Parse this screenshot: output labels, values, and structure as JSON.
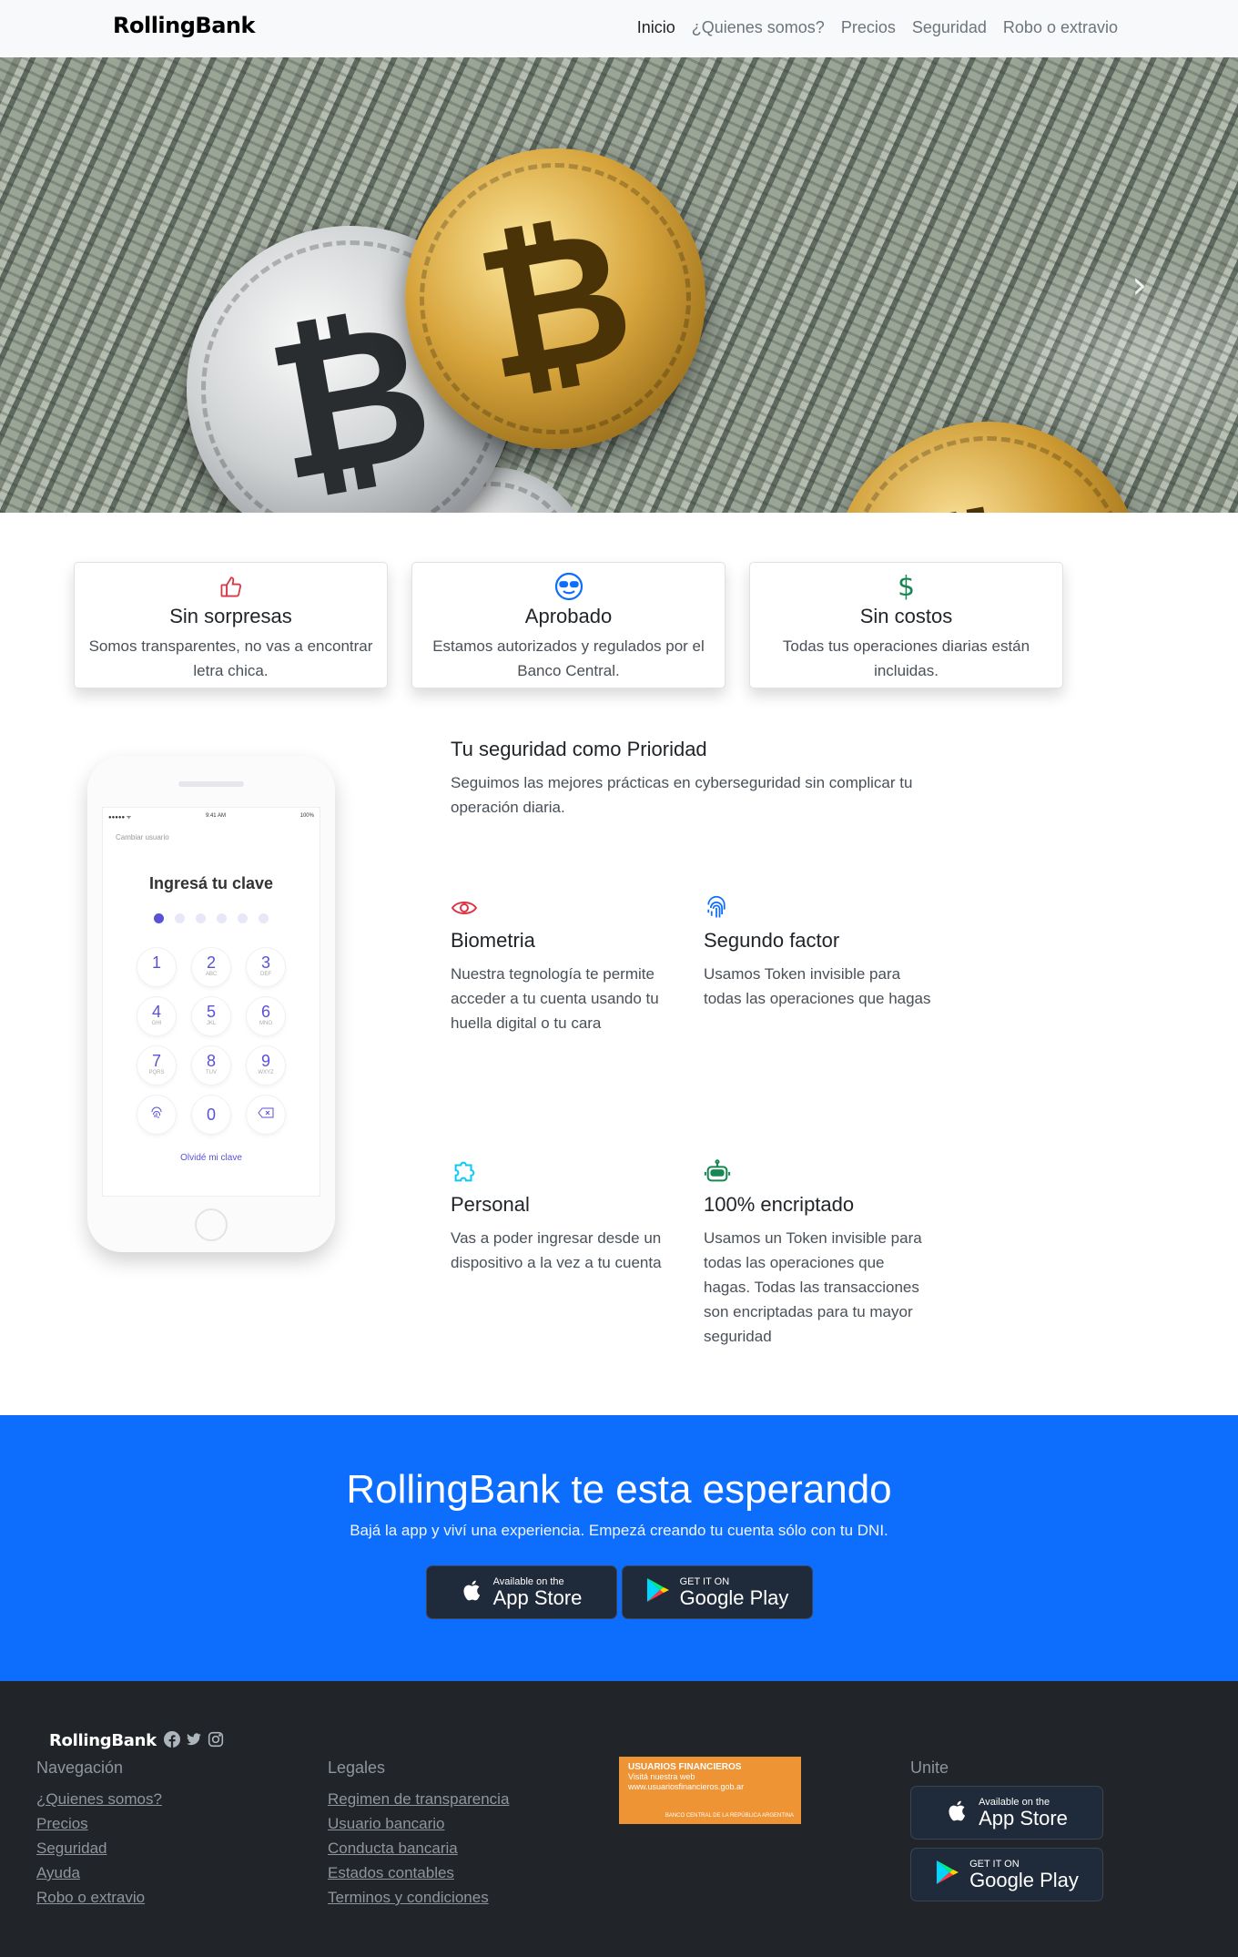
{
  "nav": {
    "brand": "RollingBank",
    "links": [
      "Inicio",
      "¿Quienes somos?",
      "Precios",
      "Seguridad",
      "Robo o extravio"
    ]
  },
  "hero": {
    "coin_symbol": "₿",
    "next_arrow": "›"
  },
  "features": [
    {
      "icon": "thumbs-up-icon",
      "title": "Sin sorpresas",
      "text": "Somos transparentes, no vas a encontrar letra chica."
    },
    {
      "icon": "sunglasses-emoji-icon",
      "title": "Aprobado",
      "text": "Estamos autorizados y regulados por el Banco Central."
    },
    {
      "icon": "dollar-icon",
      "title": "Sin costos",
      "text": "Todas tus operaciones diarias están incluidas."
    }
  ],
  "phone": {
    "status_left": "●●●●● ᯤ",
    "status_time": "9:41 AM",
    "status_right": "100%",
    "switch_user": "Cambiar usuario",
    "title": "Ingresá tu clave",
    "keys": [
      {
        "d": "1",
        "l": ""
      },
      {
        "d": "2",
        "l": "ABC"
      },
      {
        "d": "3",
        "l": "DEF"
      },
      {
        "d": "4",
        "l": "GHI"
      },
      {
        "d": "5",
        "l": "JKL"
      },
      {
        "d": "6",
        "l": "MNO"
      },
      {
        "d": "7",
        "l": "PQRS"
      },
      {
        "d": "8",
        "l": "TUV"
      },
      {
        "d": "9",
        "l": "WXYZ"
      }
    ],
    "zero": "0",
    "forgot": "Olvidé mi clave"
  },
  "security": {
    "title": "Tu seguridad como Prioridad",
    "subtitle": "Seguimos las mejores prácticas en cyberseguridad sin complicar tu operación diaria.",
    "items": [
      {
        "icon": "eye-icon",
        "title": "Biometria",
        "text": "Nuestra tegnología te permite acceder a tu cuenta usando tu huella digital o tu cara"
      },
      {
        "icon": "fingerprint-icon",
        "title": "Segundo factor",
        "text": "Usamos Token invisible para todas las operaciones que hagas"
      },
      {
        "icon": "puzzle-icon",
        "title": "Personal",
        "text": "Vas a poder ingresar desde un dispositivo a la vez a tu cuenta"
      },
      {
        "icon": "robot-icon",
        "title": "100% encriptado",
        "text": "Usamos un Token invisible para todas las operaciones que hagas. Todas las transacciones son encriptadas para tu mayor seguridad"
      }
    ]
  },
  "cta": {
    "title": "RollingBank te esta esperando",
    "subtitle": "Bajá la app y viví una experiencia. Empezá creando tu cuenta sólo con tu DNI.",
    "appstore_small": "Available on the",
    "appstore_big": "App Store",
    "googleplay_small": "GET IT ON",
    "googleplay_big": "Google Play"
  },
  "footer": {
    "brand": "RollingBank",
    "nav_title": "Navegación",
    "nav_links": [
      "¿Quienes somos?",
      "Precios",
      "Seguridad",
      "Ayuda",
      "Robo o extravio"
    ],
    "legal_title": "Legales",
    "legal_links": [
      "Regimen de transparencia",
      "Usuario bancario",
      "Conducta bancaria",
      "Estados contables",
      "Terminos y condiciones"
    ],
    "uf_title": "USUARIOS FINANCIEROS",
    "uf_line1": "Visitá nuestra web",
    "uf_line2": "www.usuariosfinancieros.gob.ar",
    "uf_org": "BANCO CENTRAL DE LA REPÚBLICA ARGENTINA",
    "unite_title": "Unite"
  },
  "colors": {
    "primary": "#0d6efd",
    "footer_bg": "#212529",
    "danger": "#dc3545",
    "success": "#198754",
    "info": "#0dcaf0",
    "uf_orange": "#ef9434"
  }
}
